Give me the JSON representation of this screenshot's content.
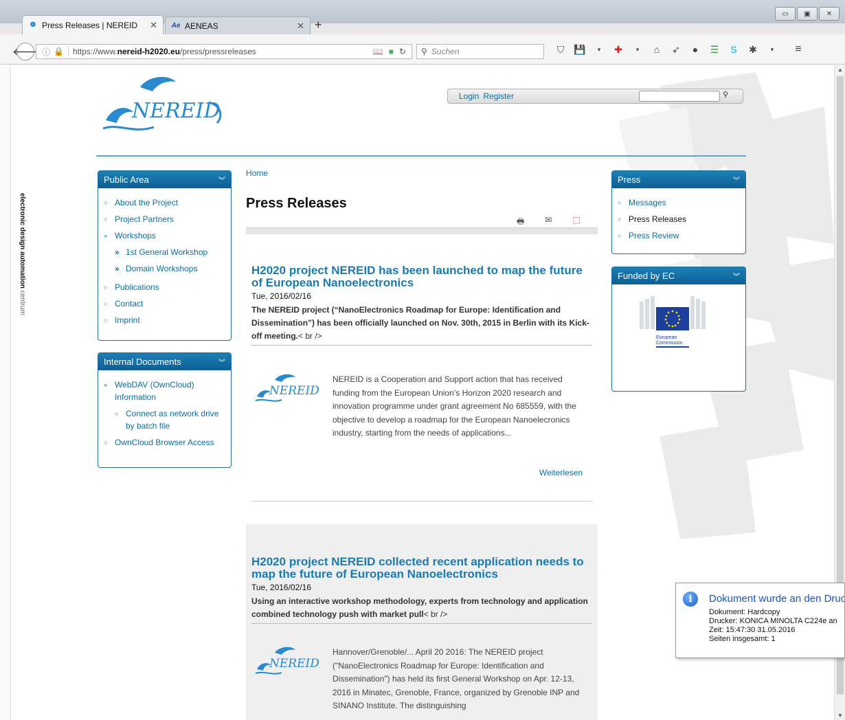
{
  "browser": {
    "tabs": [
      {
        "label": "Press Releases | NEREID",
        "active": true
      },
      {
        "label": "AENEAS",
        "active": false
      }
    ],
    "new_tab": "+",
    "url_prefix": "https://www.",
    "url_domain": "nereid-h2020.eu",
    "url_path": "/press/pressreleases",
    "search_placeholder": "Suchen",
    "window_buttons": [
      "▭",
      "▣",
      "✕"
    ]
  },
  "side_label": {
    "bold": "electronic design automation",
    "light": "centrum"
  },
  "header": {
    "login": "Login",
    "register": "Register"
  },
  "public_area": {
    "title": "Public Area",
    "items": [
      {
        "label": "About the Project",
        "bullet": "○"
      },
      {
        "label": "Project Partners",
        "bullet": "○"
      },
      {
        "label": "Workshops",
        "bullet": "»"
      },
      {
        "label": "1st General Workshop",
        "bullet": "»"
      },
      {
        "label": "Domain Workshops",
        "bullet": "»"
      },
      {
        "label": "Publications",
        "bullet": "○"
      },
      {
        "label": "Contact",
        "bullet": "○"
      },
      {
        "label": "Imprint",
        "bullet": "○"
      }
    ]
  },
  "internal_docs": {
    "title": "Internal Documents",
    "items": [
      {
        "label": "WebDAV (OwnCloud) Information",
        "bullet": "»"
      },
      {
        "label": "Connect as network drive by batch file",
        "bullet": "○"
      },
      {
        "label": "OwnCloud Browser Access",
        "bullet": "○"
      }
    ]
  },
  "main": {
    "breadcrumb": "Home",
    "title": "Press Releases",
    "articles": [
      {
        "title": "H2020 project NEREID has been launched to map the future of European Nanoelectronics",
        "date": "Tue, 2016/02/16",
        "summary": "The NEREID project (“NanoElectronics Roadmap for Europe: Identification and Dissemination”) has been officially launched on Nov. 30th, 2015 in Berlin with its Kick-off meeting.",
        "summary_tail": "< br />",
        "body": "NEREID is a Cooperation and Support action that has received funding from the European Union’s Horizon 2020 research and innovation programme under grant agreement No 685559, with the objective to develop a roadmap for the European Nanoelecronics industry, starting from the needs of applications...",
        "readmore": "Weiterlesen"
      },
      {
        "title": "H2020 project NEREID collected recent application needs to map the future of European Nanoelectronics",
        "date": "Tue, 2016/02/16",
        "summary": "Using an interactive workshop methodology, experts from technology and application combined technology push with market pull",
        "summary_tail": "< br />",
        "body": "Hannover/Grenoble/... April 20 2016:  The NEREID project (\"NanoElectronics Roadmap for Europe: Identification and Dissemination\") has held its first General Workshop on Apr. 12-13, 2016 in Minatec, Grenoble, France, organized by Grenoble INP and SINANO Institute. The distinguishing"
      }
    ]
  },
  "press": {
    "title": "Press",
    "items": [
      {
        "label": "Messages",
        "bullet": "○"
      },
      {
        "label": "Press Releases",
        "bullet": "○"
      },
      {
        "label": "Press Review",
        "bullet": "○"
      }
    ]
  },
  "funded": {
    "title": "Funded by EC",
    "logo_text_1": "European",
    "logo_text_2": "Commission"
  },
  "notification": {
    "title": "Dokument wurde an den Drucker gesendet",
    "lines": [
      "Dokument: Hardcopy",
      "Drucker: KONICA MINOLTA C224e an",
      "Zeit: 15:47:30 31.05.2016",
      "Seiten insgesamt: 1"
    ]
  },
  "colors": {
    "accent": "#0c5f94",
    "link": "#0a6fa3",
    "article_title": "#1a7ab2"
  }
}
